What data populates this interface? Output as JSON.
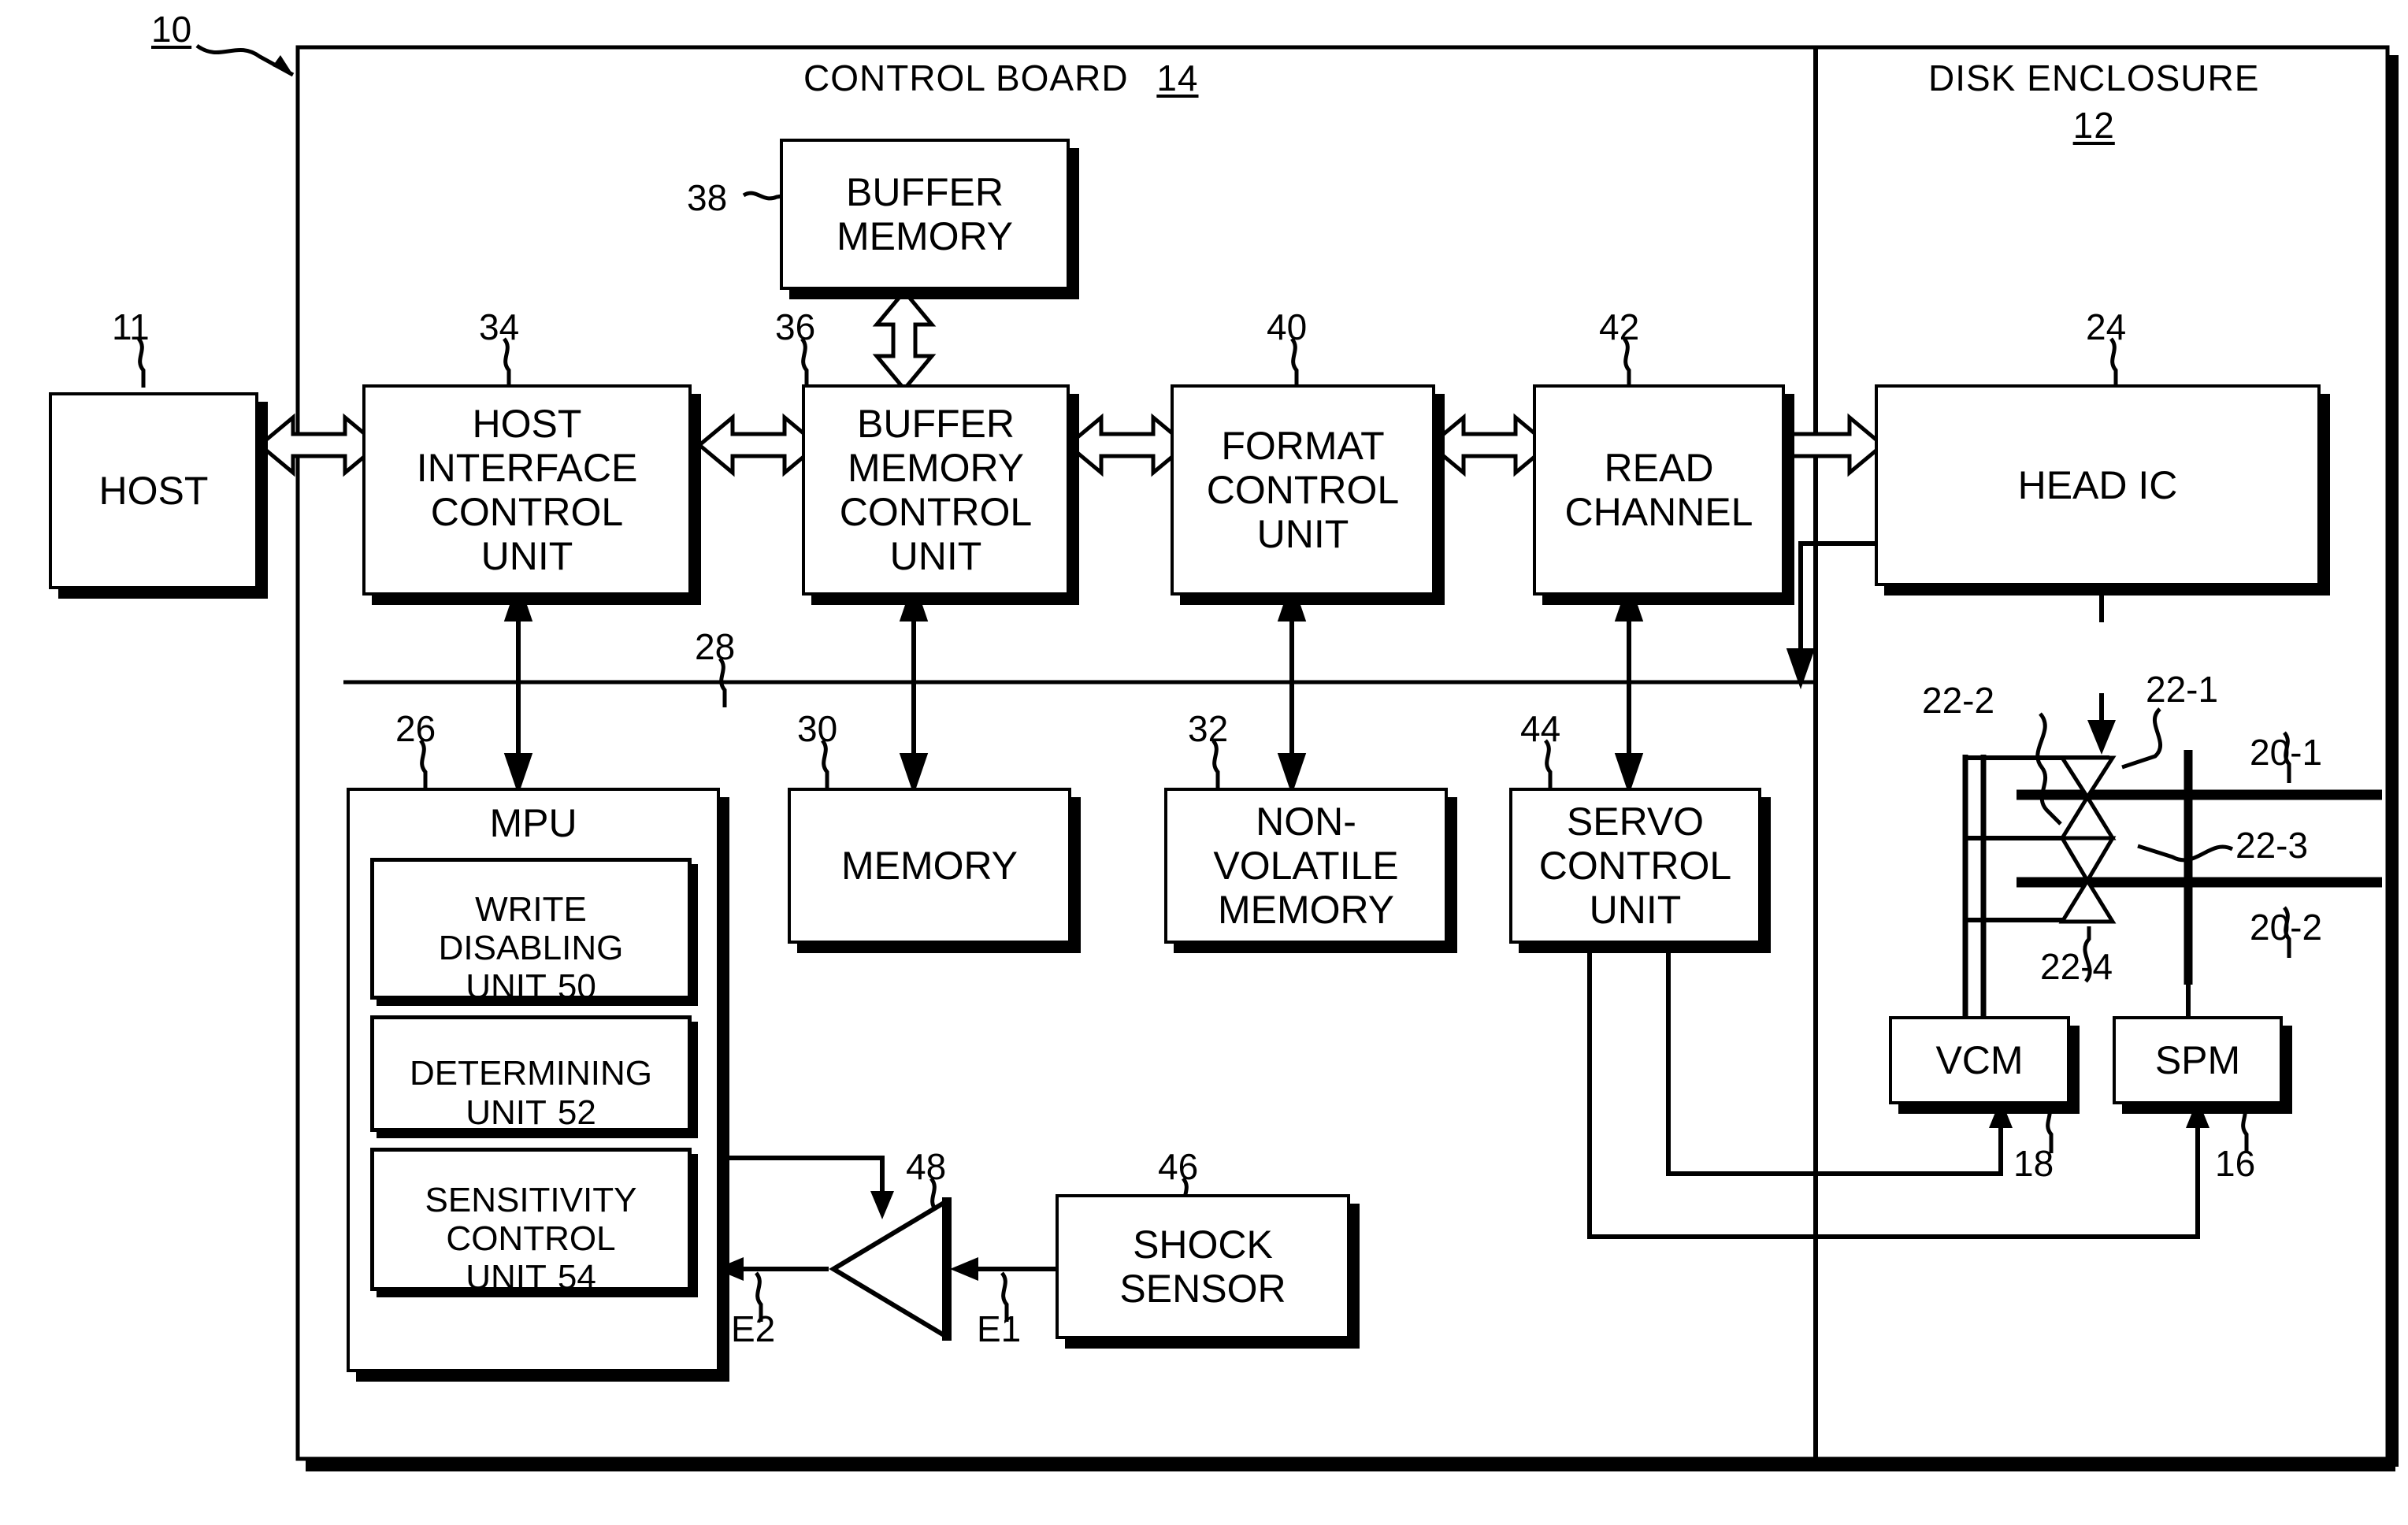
{
  "figure": {
    "system_ref": "10",
    "sections": [
      {
        "name": "control_board",
        "title": "CONTROL BOARD",
        "ref": "14"
      },
      {
        "name": "disk_enclosure",
        "title": "DISK ENCLOSURE",
        "ref": "12"
      }
    ]
  },
  "blocks": {
    "host": {
      "label": "HOST",
      "ref": "11"
    },
    "host_if": {
      "label": "HOST\nINTERFACE\nCONTROL\nUNIT",
      "ref": "34"
    },
    "buf_mem": {
      "label": "BUFFER\nMEMORY",
      "ref": "38"
    },
    "buf_ctl": {
      "label": "BUFFER\nMEMORY\nCONTROL\nUNIT",
      "ref": "36"
    },
    "fmt_ctl": {
      "label": "FORMAT\nCONTROL\nUNIT",
      "ref": "40"
    },
    "read_ch": {
      "label": "READ\nCHANNEL",
      "ref": "42"
    },
    "head_ic": {
      "label": "HEAD IC",
      "ref": "24"
    },
    "mpu": {
      "label": "MPU",
      "ref": "26"
    },
    "memory": {
      "label": "MEMORY",
      "ref": "30"
    },
    "nvram": {
      "label": "NON-\nVOLATILE\nMEMORY",
      "ref": "32"
    },
    "servo": {
      "label": "SERVO\nCONTROL\nUNIT",
      "ref": "44"
    },
    "shock": {
      "label": "SHOCK\nSENSOR",
      "ref": "46"
    },
    "vcm": {
      "label": "VCM",
      "ref": "18"
    },
    "spm": {
      "label": "SPM",
      "ref": "16"
    }
  },
  "mpu_units": [
    {
      "label": "WRITE\nDISABLING\nUNIT",
      "ref": "50"
    },
    {
      "label": "DETERMINING\nUNIT",
      "ref": "52"
    },
    {
      "label": "SENSITIVITY\nCONTROL\nUNIT",
      "ref": "54"
    }
  ],
  "bus": {
    "ref": "28"
  },
  "amplifier": {
    "ref": "48",
    "input_signal": "E1",
    "output_signal": "E2"
  },
  "disks": [
    {
      "ref": "20-1"
    },
    {
      "ref": "20-2"
    }
  ],
  "heads": [
    {
      "ref": "22-1"
    },
    {
      "ref": "22-2"
    },
    {
      "ref": "22-3"
    },
    {
      "ref": "22-4"
    }
  ],
  "colors": {
    "ink": "#000000",
    "paper": "#ffffff"
  }
}
